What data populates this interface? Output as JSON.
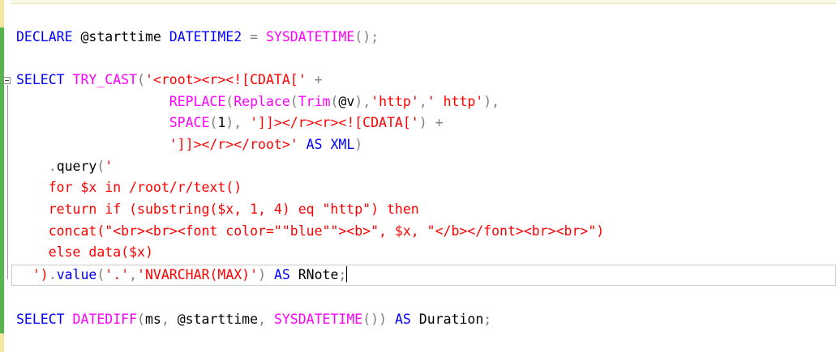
{
  "editor": {
    "colors": {
      "keyword": "#0000ff",
      "function": "#ff00ff",
      "string": "#ff0000",
      "operator": "#808080",
      "text": "#000000",
      "change_bar_saved": "#57b44f",
      "change_bar_unsaved": "#f3e7a0"
    },
    "icons": {
      "collapse": "minus-box-icon"
    },
    "lines": [
      {
        "tokens": [
          {
            "t": "DECLARE",
            "c": "kw"
          },
          {
            "t": " @starttime ",
            "c": "var"
          },
          {
            "t": "DATETIME2",
            "c": "kw"
          },
          {
            "t": " ",
            "c": "var"
          },
          {
            "t": "=",
            "c": "op"
          },
          {
            "t": " ",
            "c": "var"
          },
          {
            "t": "SYSDATETIME",
            "c": "fn"
          },
          {
            "t": "();",
            "c": "op"
          }
        ]
      },
      {
        "tokens": []
      },
      {
        "tokens": [
          {
            "t": "SELECT",
            "c": "kw"
          },
          {
            "t": " ",
            "c": "var"
          },
          {
            "t": "TRY_CAST",
            "c": "fn"
          },
          {
            "t": "(",
            "c": "op"
          },
          {
            "t": "'<root><r><![CDATA['",
            "c": "str"
          },
          {
            "t": " ",
            "c": "var"
          },
          {
            "t": "+",
            "c": "op"
          }
        ]
      },
      {
        "tokens": [
          {
            "t": "                   ",
            "c": "var"
          },
          {
            "t": "REPLACE",
            "c": "fn"
          },
          {
            "t": "(",
            "c": "op"
          },
          {
            "t": "Replace",
            "c": "fn"
          },
          {
            "t": "(",
            "c": "op"
          },
          {
            "t": "Trim",
            "c": "fn"
          },
          {
            "t": "(",
            "c": "op"
          },
          {
            "t": "@v",
            "c": "var"
          },
          {
            "t": "),",
            "c": "op"
          },
          {
            "t": "'http'",
            "c": "str"
          },
          {
            "t": ",",
            "c": "op"
          },
          {
            "t": "' http'",
            "c": "str"
          },
          {
            "t": "),",
            "c": "op"
          }
        ]
      },
      {
        "tokens": [
          {
            "t": "                   ",
            "c": "var"
          },
          {
            "t": "SPACE",
            "c": "fn"
          },
          {
            "t": "(",
            "c": "op"
          },
          {
            "t": "1",
            "c": "var"
          },
          {
            "t": "),",
            "c": "op"
          },
          {
            "t": " ",
            "c": "var"
          },
          {
            "t": "']]></r><r><![CDATA['",
            "c": "str"
          },
          {
            "t": ")",
            "c": "op"
          },
          {
            "t": " ",
            "c": "var"
          },
          {
            "t": "+",
            "c": "op"
          }
        ]
      },
      {
        "tokens": [
          {
            "t": "                   ",
            "c": "var"
          },
          {
            "t": "']]></r></root>'",
            "c": "str"
          },
          {
            "t": " ",
            "c": "var"
          },
          {
            "t": "AS",
            "c": "kw"
          },
          {
            "t": " ",
            "c": "var"
          },
          {
            "t": "XML",
            "c": "kw"
          },
          {
            "t": ")",
            "c": "op"
          }
        ]
      },
      {
        "tokens": [
          {
            "t": "    ",
            "c": "var"
          },
          {
            "t": ".",
            "c": "op"
          },
          {
            "t": "query",
            "c": "var"
          },
          {
            "t": "(",
            "c": "op"
          },
          {
            "t": "'",
            "c": "str"
          }
        ]
      },
      {
        "tokens": [
          {
            "t": "    ",
            "c": "var"
          },
          {
            "t": "for $x in /root/r/text()",
            "c": "str"
          }
        ]
      },
      {
        "tokens": [
          {
            "t": "    ",
            "c": "var"
          },
          {
            "t": "return if (substring($x, 1, 4) eq \"http\") then",
            "c": "str"
          }
        ]
      },
      {
        "tokens": [
          {
            "t": "    ",
            "c": "var"
          },
          {
            "t": "concat(\"<br><br><font color=\"\"blue\"\"><b>\", $x, \"</b></font><br><br>\")",
            "c": "str"
          }
        ]
      },
      {
        "tokens": [
          {
            "t": "    ",
            "c": "var"
          },
          {
            "t": "else data($x)",
            "c": "str"
          }
        ]
      },
      {
        "tokens": [
          {
            "t": "  ",
            "c": "var"
          },
          {
            "t": "')",
            "c": "str"
          },
          {
            "t": ".",
            "c": "op"
          },
          {
            "t": "value",
            "c": "kw"
          },
          {
            "t": "(",
            "c": "op"
          },
          {
            "t": "'.'",
            "c": "str"
          },
          {
            "t": ",",
            "c": "op"
          },
          {
            "t": "'NVARCHAR(MAX)'",
            "c": "str"
          },
          {
            "t": ")",
            "c": "op"
          },
          {
            "t": " ",
            "c": "var"
          },
          {
            "t": "AS",
            "c": "kw"
          },
          {
            "t": " RNote",
            "c": "var"
          },
          {
            "t": ";",
            "c": "op"
          }
        ]
      },
      {
        "tokens": []
      },
      {
        "tokens": [
          {
            "t": "SELECT",
            "c": "kw"
          },
          {
            "t": " ",
            "c": "var"
          },
          {
            "t": "DATEDIFF",
            "c": "fn"
          },
          {
            "t": "(",
            "c": "op"
          },
          {
            "t": "ms",
            "c": "var"
          },
          {
            "t": ",",
            "c": "op"
          },
          {
            "t": " @starttime",
            "c": "var"
          },
          {
            "t": ",",
            "c": "op"
          },
          {
            "t": " ",
            "c": "var"
          },
          {
            "t": "SYSDATETIME",
            "c": "fn"
          },
          {
            "t": "())",
            "c": "op"
          },
          {
            "t": " ",
            "c": "var"
          },
          {
            "t": "AS",
            "c": "kw"
          },
          {
            "t": " Duration",
            "c": "var"
          },
          {
            "t": ";",
            "c": "op"
          }
        ]
      }
    ]
  }
}
